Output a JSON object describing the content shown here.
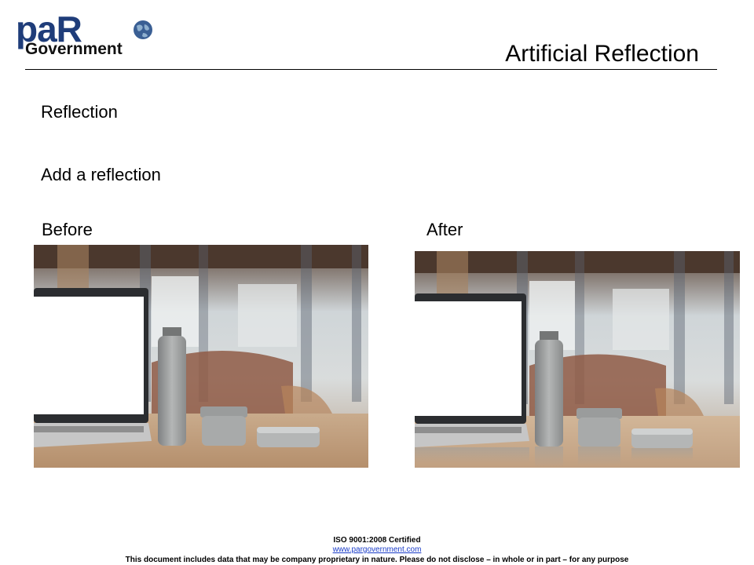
{
  "logo": {
    "main_text": "paR",
    "sub_text": "Government",
    "icon": "globe-icon"
  },
  "slide": {
    "title": "Artificial Reflection",
    "heading": "Reflection",
    "subheading": "Add a reflection"
  },
  "images": {
    "before_label": "Before",
    "after_label": "After"
  },
  "footer": {
    "certification": "ISO 9001:2008 Certified",
    "website": "www.pargovernment.com",
    "disclaimer": "This document includes data that may be company proprietary in nature. Please do not disclose – in whole or in part – for any purpose"
  },
  "colors": {
    "logo_blue": "#1f3d7a",
    "link_blue": "#1a3cc8"
  }
}
